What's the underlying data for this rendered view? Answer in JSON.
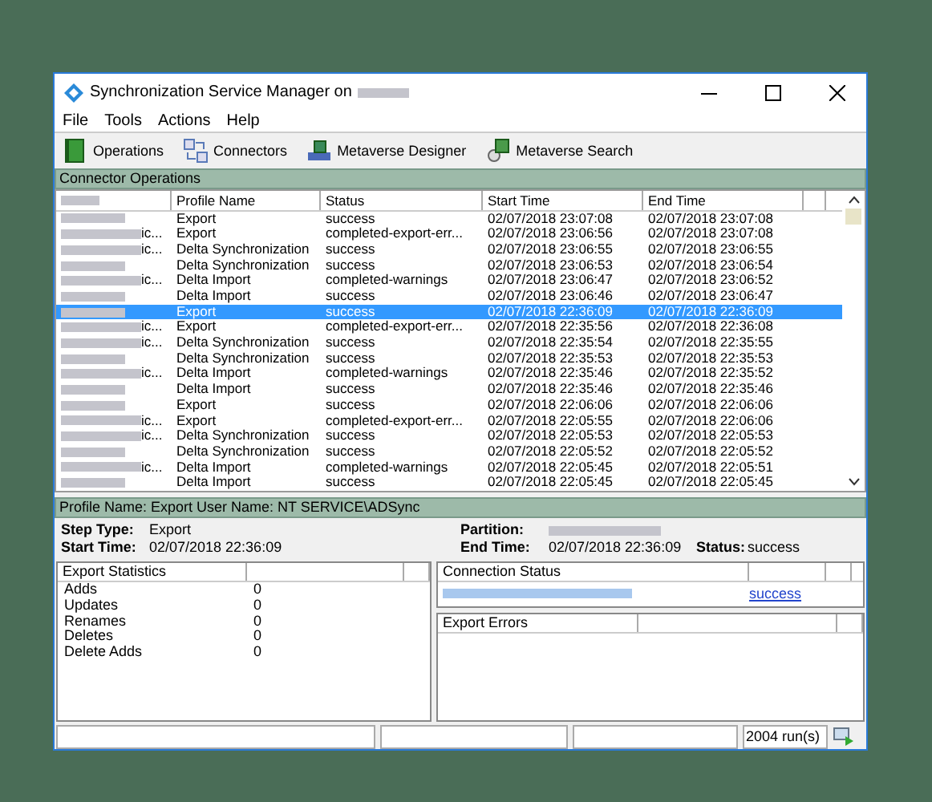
{
  "window": {
    "title": "Synchronization Service Manager on"
  },
  "menu": [
    "File",
    "Tools",
    "Actions",
    "Help"
  ],
  "toolbar": [
    {
      "kind": "operations",
      "label": "Operations"
    },
    {
      "kind": "connectors",
      "label": "Connectors"
    },
    {
      "kind": "designer",
      "label": "Metaverse Designer"
    },
    {
      "kind": "search",
      "label": "Metaverse Search"
    }
  ],
  "operations": {
    "title": "Connector Operations",
    "columns": [
      "Profile Name",
      "Status",
      "Start Time",
      "End Time"
    ],
    "rows": [
      {
        "name_suffix": "",
        "profile": "Export",
        "status": "success",
        "start": "02/07/2018 23:07:08",
        "end": "02/07/2018 23:07:08",
        "selected": false
      },
      {
        "name_suffix": "ic...",
        "profile": "Export",
        "status": "completed-export-err...",
        "start": "02/07/2018 23:06:56",
        "end": "02/07/2018 23:07:08",
        "selected": false
      },
      {
        "name_suffix": "ic...",
        "profile": "Delta Synchronization",
        "status": "success",
        "start": "02/07/2018 23:06:55",
        "end": "02/07/2018 23:06:55",
        "selected": false
      },
      {
        "name_suffix": "",
        "profile": "Delta Synchronization",
        "status": "success",
        "start": "02/07/2018 23:06:53",
        "end": "02/07/2018 23:06:54",
        "selected": false
      },
      {
        "name_suffix": "ic...",
        "profile": "Delta Import",
        "status": "completed-warnings",
        "start": "02/07/2018 23:06:47",
        "end": "02/07/2018 23:06:52",
        "selected": false
      },
      {
        "name_suffix": "",
        "profile": "Delta Import",
        "status": "success",
        "start": "02/07/2018 23:06:46",
        "end": "02/07/2018 23:06:47",
        "selected": false
      },
      {
        "name_suffix": "",
        "profile": "Export",
        "status": "success",
        "start": "02/07/2018 22:36:09",
        "end": "02/07/2018 22:36:09",
        "selected": true
      },
      {
        "name_suffix": "ic...",
        "profile": "Export",
        "status": "completed-export-err...",
        "start": "02/07/2018 22:35:56",
        "end": "02/07/2018 22:36:08",
        "selected": false
      },
      {
        "name_suffix": "ic...",
        "profile": "Delta Synchronization",
        "status": "success",
        "start": "02/07/2018 22:35:54",
        "end": "02/07/2018 22:35:55",
        "selected": false
      },
      {
        "name_suffix": "",
        "profile": "Delta Synchronization",
        "status": "success",
        "start": "02/07/2018 22:35:53",
        "end": "02/07/2018 22:35:53",
        "selected": false
      },
      {
        "name_suffix": "ic...",
        "profile": "Delta Import",
        "status": "completed-warnings",
        "start": "02/07/2018 22:35:46",
        "end": "02/07/2018 22:35:52",
        "selected": false
      },
      {
        "name_suffix": "",
        "profile": "Delta Import",
        "status": "success",
        "start": "02/07/2018 22:35:46",
        "end": "02/07/2018 22:35:46",
        "selected": false
      },
      {
        "name_suffix": "",
        "profile": "Export",
        "status": "success",
        "start": "02/07/2018 22:06:06",
        "end": "02/07/2018 22:06:06",
        "selected": false
      },
      {
        "name_suffix": "ic...",
        "profile": "Export",
        "status": "completed-export-err...",
        "start": "02/07/2018 22:05:55",
        "end": "02/07/2018 22:06:06",
        "selected": false
      },
      {
        "name_suffix": "ic...",
        "profile": "Delta Synchronization",
        "status": "success",
        "start": "02/07/2018 22:05:53",
        "end": "02/07/2018 22:05:53",
        "selected": false
      },
      {
        "name_suffix": "",
        "profile": "Delta Synchronization",
        "status": "success",
        "start": "02/07/2018 22:05:52",
        "end": "02/07/2018 22:05:52",
        "selected": false
      },
      {
        "name_suffix": "ic...",
        "profile": "Delta Import",
        "status": "completed-warnings",
        "start": "02/07/2018 22:05:45",
        "end": "02/07/2018 22:05:51",
        "selected": false
      },
      {
        "name_suffix": "",
        "profile": "Delta Import",
        "status": "success",
        "start": "02/07/2018 22:05:45",
        "end": "02/07/2018 22:05:45",
        "selected": false
      }
    ]
  },
  "details": {
    "header": "Profile Name: Export  User Name: NT SERVICE\\ADSync",
    "step_type": {
      "label": "Step Type:",
      "value": "Export"
    },
    "start_time": {
      "label": "Start Time:",
      "value": "02/07/2018 22:36:09"
    },
    "partition": {
      "label": "Partition:"
    },
    "end_time": {
      "label": "End Time:",
      "value": "02/07/2018 22:36:09"
    },
    "status": {
      "label": "Status:",
      "value": "success"
    }
  },
  "export_statistics": {
    "title": "Export Statistics",
    "items": [
      {
        "label": "Adds",
        "value": "0"
      },
      {
        "label": "Updates",
        "value": "0"
      },
      {
        "label": "Renames",
        "value": "0"
      },
      {
        "label": "Deletes",
        "value": "0"
      },
      {
        "label": "Delete Adds",
        "value": "0"
      }
    ]
  },
  "connection_status": {
    "title": "Connection Status",
    "link": "success"
  },
  "export_errors": {
    "title": "Export Errors"
  },
  "status_bar": {
    "runs": "2004 run(s)"
  }
}
